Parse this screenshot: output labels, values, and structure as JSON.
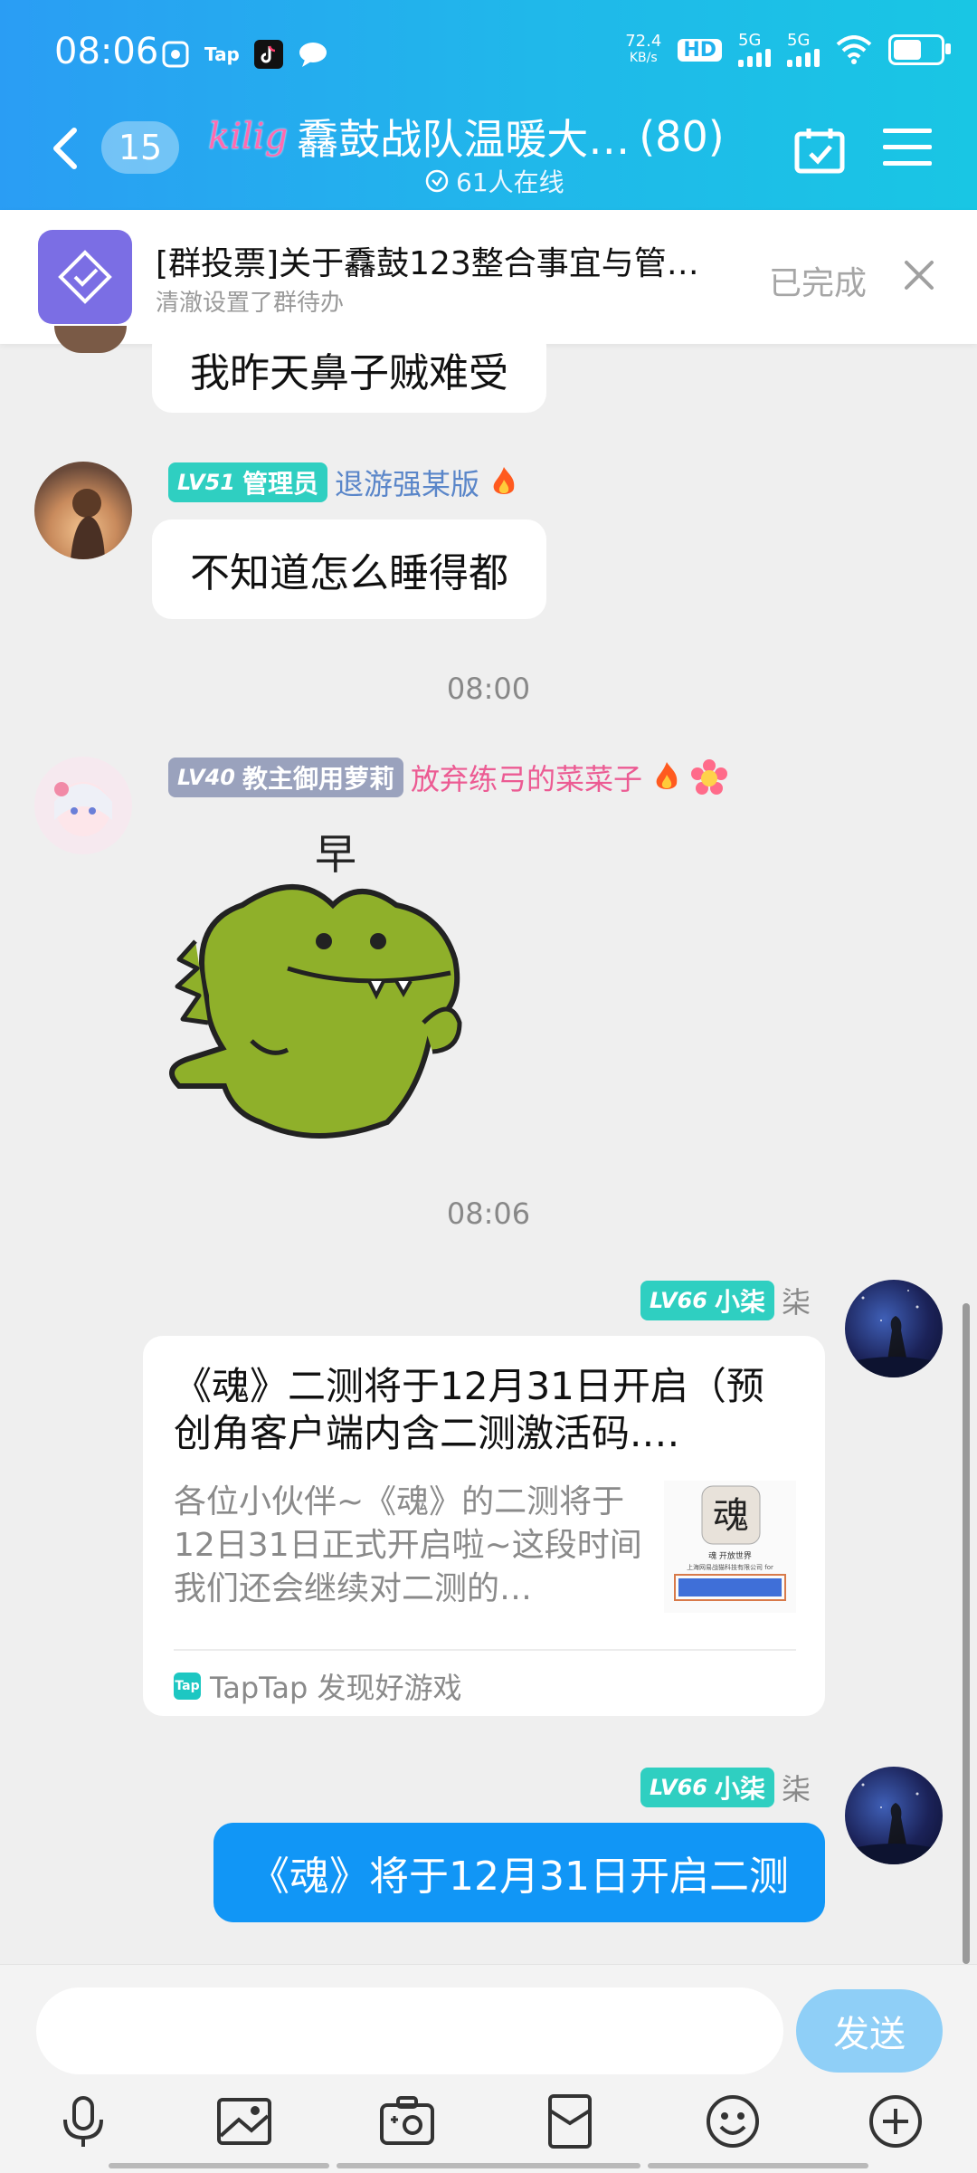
{
  "status_bar": {
    "time": "08:06",
    "app_icons": [
      "scan-icon",
      "Tap",
      "tiktok-icon",
      "chat-bubble-icon"
    ],
    "net_speed_value": "72.4",
    "net_speed_unit": "KB/s",
    "hd_label": "HD",
    "sim1": "5G",
    "sim2": "5G"
  },
  "header": {
    "unread_count": "15",
    "title_badge": "kilig",
    "group_name": "馫鼓战队温暖大…",
    "member_count": "(80)",
    "online_text": "61人在线"
  },
  "poll": {
    "title": "[群投票]关于馫鼓123整合事宜与管…",
    "subtitle": "清澈设置了群待办",
    "status": "已完成"
  },
  "messages": [
    {
      "text": "我昨天鼻子贼难受"
    },
    {
      "level": "LV51",
      "role": "管理员",
      "sender": "退游强某版",
      "text": "不知道怎么睡得都"
    },
    {
      "time": "08:00"
    },
    {
      "level": "LV40",
      "role": "教主御用萝莉",
      "sender": "放弃练弓的菜菜子",
      "sticker_text": "早"
    },
    {
      "time": "08:06"
    },
    {
      "level": "LV66",
      "role": "小柒",
      "sender": "柒",
      "card": {
        "title": "《魂》二测将于12月31日开启（预创角客户端内含二测激活码.…",
        "description": "各位小伙伴~《魂》的二测将于12日31日正式开启啦~这段时间我们还会继续对二测的…",
        "thumb_text_1": "魂 开放世界",
        "thumb_text_2": "上海网易战猫科技有限公司 for",
        "source": "TapTap 发现好游戏",
        "source_icon": "Tap"
      }
    },
    {
      "level": "LV66",
      "role": "小柒",
      "sender": "柒",
      "text": "《魂》将于12月31日开启二测"
    }
  ],
  "input": {
    "placeholder": "",
    "send_label": "发送"
  },
  "colors": {
    "header_gradient_start": "#2a9df4",
    "header_gradient_end": "#19c6e4",
    "lv51": "#2fcfc1",
    "lv40": "#9aa2bd",
    "lv66": "#2fcfc1",
    "sender_blue": "#5a86c9",
    "sender_pink": "#ec5b93",
    "self_bubble": "#1196f6",
    "send_button": "#8fcff7"
  }
}
